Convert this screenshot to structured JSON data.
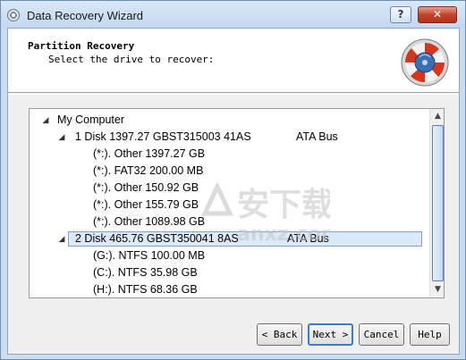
{
  "window": {
    "title": "Data Recovery Wizard",
    "help_button": "?",
    "close_button": "✕"
  },
  "header": {
    "title": "Partition Recovery",
    "subtitle": "Select the drive to recover:",
    "logo_icon": "lifebuoy-disk-icon"
  },
  "tree": {
    "root": {
      "label": "My Computer",
      "expanded": true
    },
    "rows": [
      {
        "label": "1 Disk 1397.27 GBST315003 41AS",
        "bus": "ATA Bus",
        "level": 1,
        "expanded": true,
        "selected": false
      },
      {
        "label": "(*:). Other 1397.27 GB",
        "level": 2
      },
      {
        "label": "(*:). FAT32 200.00 MB",
        "level": 2
      },
      {
        "label": "(*:). Other 150.92 GB",
        "level": 2
      },
      {
        "label": "(*:). Other 155.79 GB",
        "level": 2
      },
      {
        "label": "(*:). Other 1089.98 GB",
        "level": 2
      },
      {
        "label": "2 Disk 465.76 GBST350041 8AS",
        "bus": "ATA Bus",
        "level": 1,
        "expanded": true,
        "selected": true
      },
      {
        "label": "(G:). NTFS 100.00 MB",
        "level": 2
      },
      {
        "label": "(C:). NTFS 35.98 GB",
        "level": 2
      },
      {
        "label": "(H:). NTFS 68.36 GB",
        "level": 2
      }
    ]
  },
  "watermark": {
    "main": "安下载",
    "sub": "anxz.com"
  },
  "buttons": {
    "back": "< Back",
    "next": "Next >",
    "cancel": "Cancel",
    "help": "Help"
  }
}
